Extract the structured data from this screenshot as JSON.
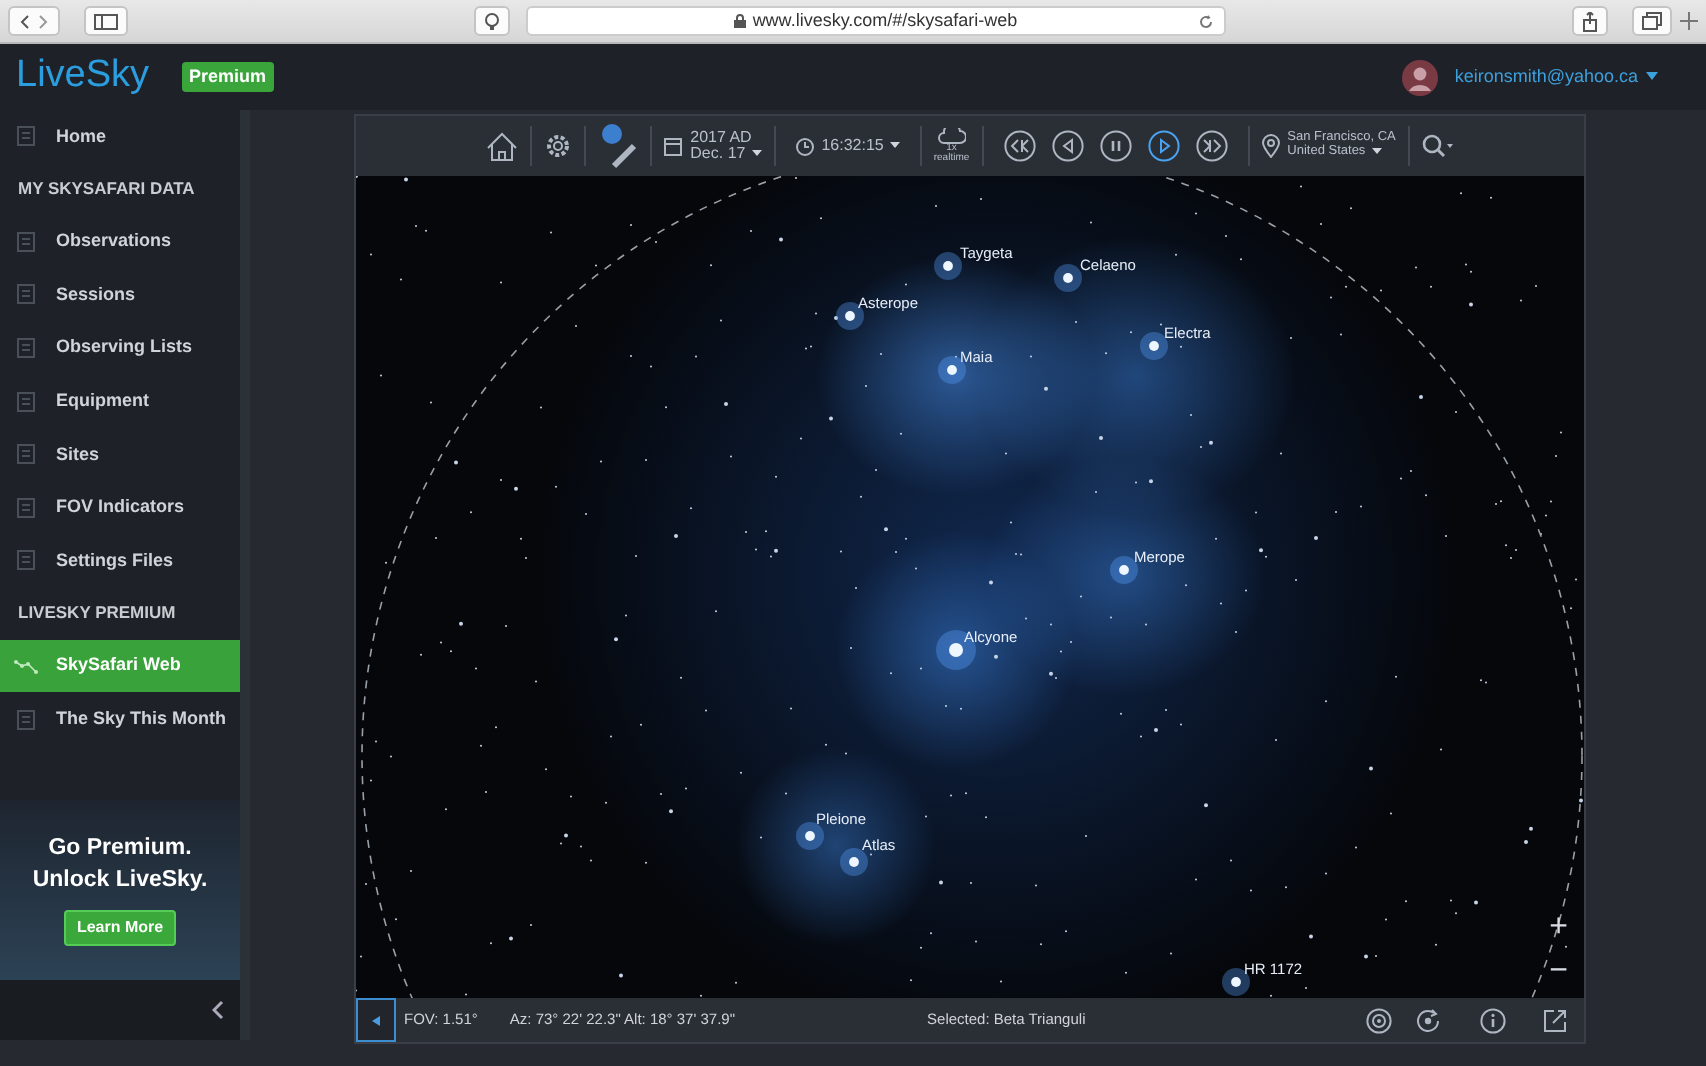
{
  "browser": {
    "url": "www.livesky.com/#/skysafari-web"
  },
  "header": {
    "logo": "LiveSky",
    "badge": "Premium",
    "user_email": "keironsmith@yahoo.ca"
  },
  "sidebar": {
    "items": [
      {
        "kind": "item",
        "label": "Home",
        "selected": false
      },
      {
        "kind": "heading",
        "label": "MY SKYSAFARI DATA"
      },
      {
        "kind": "item",
        "label": "Observations",
        "selected": false
      },
      {
        "kind": "item",
        "label": "Sessions",
        "selected": false
      },
      {
        "kind": "item",
        "label": "Observing Lists",
        "selected": false
      },
      {
        "kind": "item",
        "label": "Equipment",
        "selected": false
      },
      {
        "kind": "item",
        "label": "Sites",
        "selected": false
      },
      {
        "kind": "item",
        "label": "FOV Indicators",
        "selected": false
      },
      {
        "kind": "item",
        "label": "Settings Files",
        "selected": false
      },
      {
        "kind": "heading",
        "label": "LIVESKY PREMIUM"
      },
      {
        "kind": "item",
        "label": "SkySafari Web",
        "selected": true
      },
      {
        "kind": "item",
        "label": "The Sky This Month",
        "selected": false
      }
    ],
    "promo": {
      "title_lines": [
        "Go Premium.",
        "Unlock LiveSky."
      ],
      "button": "Learn More"
    }
  },
  "toolbar": {
    "date_lines": [
      "2017 AD",
      "Dec. 17"
    ],
    "time": "16:32:15",
    "rate": "1x",
    "rate_label": "realtime",
    "playback_buttons": [
      {
        "kind": "skip-back",
        "selected": false
      },
      {
        "kind": "step-back",
        "selected": false
      },
      {
        "kind": "pause",
        "selected": false
      },
      {
        "kind": "play",
        "selected": true
      },
      {
        "kind": "skip-forward",
        "selected": false
      }
    ],
    "location_lines": [
      "San Francisco, CA",
      "United States"
    ]
  },
  "sky": {
    "stars": [
      {
        "label": "Taygeta"
      },
      {
        "label": "Celaeno"
      },
      {
        "label": "Asterope"
      },
      {
        "label": "Maia"
      },
      {
        "label": "Electra"
      },
      {
        "label": "Merope"
      },
      {
        "label": "Alcyone"
      },
      {
        "label": "Pleione"
      },
      {
        "label": "Atlas"
      },
      {
        "label": "HR 1172"
      }
    ],
    "zoom_in": "+",
    "zoom_out": "−"
  },
  "status_bar": {
    "fov": "FOV: 1.51°",
    "position": "Az: 73° 22' 22.3\" Alt: 18° 37' 37.9\"",
    "selected": "Selected: Beta Trianguli"
  }
}
